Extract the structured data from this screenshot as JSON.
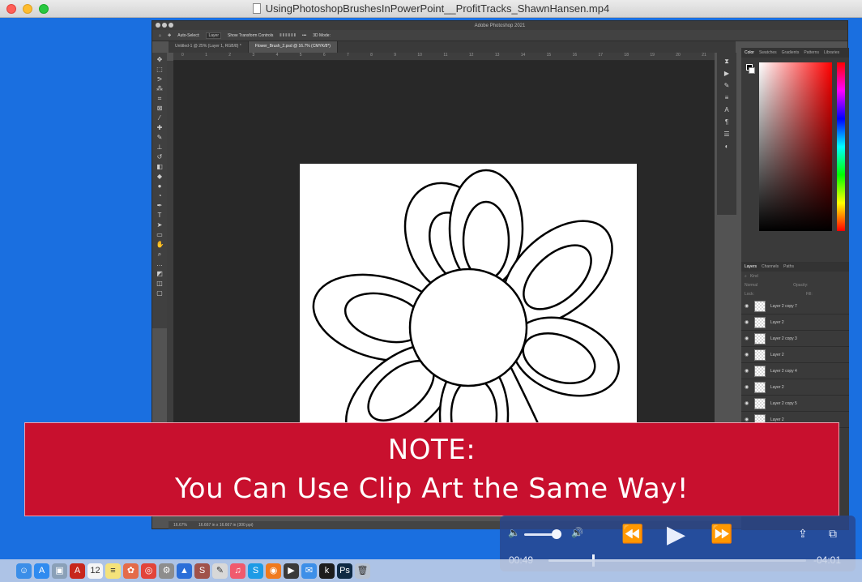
{
  "window": {
    "title": "UsingPhotoshopBrushesInPowerPoint__ProfitTracks_ShawnHansen.mp4"
  },
  "photoshop": {
    "app_title": "Adobe Photoshop 2021",
    "options": {
      "auto_select": "Auto-Select:",
      "target": "Layer",
      "transform": "Show Transform Controls",
      "mode_3d": "3D Mode:"
    },
    "tabs": [
      {
        "label": "Untitled-1 @ 25% (Layer 1, RGB/8) *"
      },
      {
        "label": "Flower_Brush_2.psd @ 16.7% (CMYK/8*)"
      }
    ],
    "ruler_ticks": [
      "0",
      "1",
      "2",
      "3",
      "4",
      "5",
      "6",
      "7",
      "8",
      "9",
      "10",
      "11",
      "12",
      "13",
      "14",
      "15",
      "16",
      "17",
      "18",
      "19",
      "20",
      "21"
    ],
    "color_tabs": [
      "Color",
      "Swatches",
      "Gradients",
      "Patterns",
      "Libraries"
    ],
    "layer_tabs": [
      "Layers",
      "Channels",
      "Paths"
    ],
    "layer_filter": "Kind",
    "blend_mode": "Normal",
    "opacity_label": "Opacity:",
    "lock_label": "Lock:",
    "fill_label": "Fill:",
    "layers": [
      {
        "name": "Layer 2 copy 7"
      },
      {
        "name": "Layer 2"
      },
      {
        "name": "Layer 2 copy 3"
      },
      {
        "name": "Layer 2"
      },
      {
        "name": "Layer 2 copy 4"
      },
      {
        "name": "Layer 2"
      },
      {
        "name": "Layer 2 copy 5"
      },
      {
        "name": "Layer 2"
      }
    ],
    "status_zoom": "16.67%",
    "status_size": "16.667 in x 16.667 in (300 ppi)"
  },
  "banner": {
    "line1": "NOTE:",
    "line2": "You Can Use Clip Art the Same Way!"
  },
  "player": {
    "elapsed": "00:49",
    "remaining": "-04:01",
    "progress_fraction": 0.17,
    "volume_fraction": 0.87,
    "icons": [
      "volume-low-icon",
      "volume-high-icon",
      "rewind-icon",
      "play-icon",
      "fast-forward-icon",
      "share-icon",
      "picture-in-picture-icon"
    ]
  },
  "dock": {
    "apps": [
      {
        "icon": "finder-icon",
        "color": "#3b8ee8"
      },
      {
        "icon": "app-store-icon",
        "color": "#2f8bf0"
      },
      {
        "icon": "preview-icon",
        "color": "#8aa0b8"
      },
      {
        "icon": "acrobat-icon",
        "color": "#c7261c"
      },
      {
        "icon": "calendar-icon",
        "color": "#f5f5f5"
      },
      {
        "icon": "notes-icon",
        "color": "#f4e27a"
      },
      {
        "icon": "photos-icon",
        "color": "#e46b4a"
      },
      {
        "icon": "chrome-icon",
        "color": "#e2443a"
      },
      {
        "icon": "system-prefs-icon",
        "color": "#8d8d8d"
      },
      {
        "icon": "keynote-icon",
        "color": "#2b6ed8"
      },
      {
        "icon": "scrivener-icon",
        "color": "#a0524a"
      },
      {
        "icon": "textedit-icon",
        "color": "#d8d8d8"
      },
      {
        "icon": "music-icon",
        "color": "#f05a6e"
      },
      {
        "icon": "skype-icon",
        "color": "#1d9be6"
      },
      {
        "icon": "firefox-icon",
        "color": "#f07a1e"
      },
      {
        "icon": "quicktime-icon",
        "color": "#3a3a3a"
      },
      {
        "icon": "mail-icon",
        "color": "#3d8fe8"
      },
      {
        "icon": "kindle-icon",
        "color": "#1c1c1c"
      },
      {
        "icon": "photoshop-icon",
        "color": "#0f2a44"
      },
      {
        "icon": "trash-icon",
        "color": "#b8c2d0"
      }
    ]
  }
}
